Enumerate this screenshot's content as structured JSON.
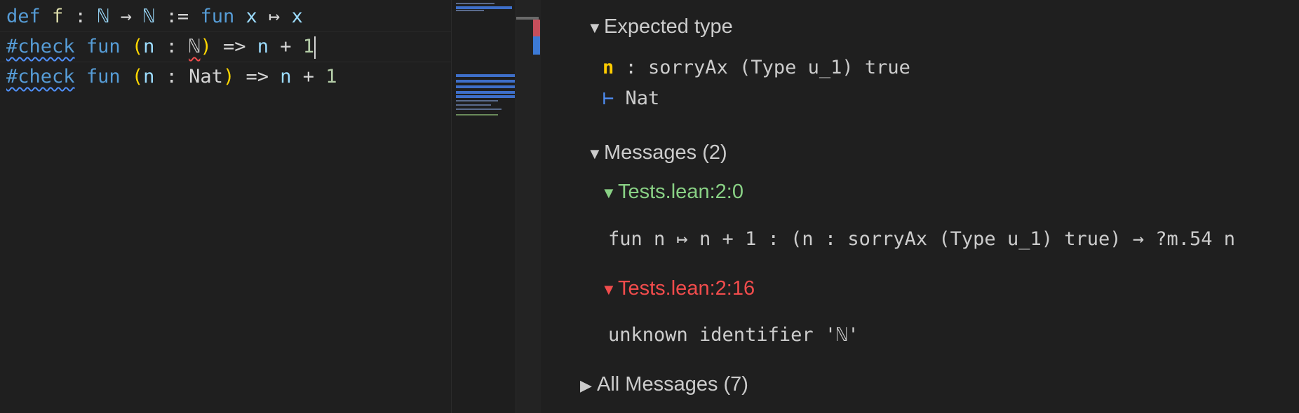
{
  "editor": {
    "lines": [
      {
        "tokens": [
          "def",
          " ",
          "f",
          " : ",
          "ℕ",
          " → ",
          "ℕ",
          " := ",
          "fun",
          " ",
          "x",
          " ↦ ",
          "x"
        ]
      },
      {
        "tokens": [
          "#check",
          " ",
          "fun",
          " ",
          "(",
          "n",
          " : ",
          "ℕ",
          ")",
          " => ",
          "n",
          " + ",
          "1"
        ]
      },
      {
        "tokens": [
          "#check",
          " ",
          "fun",
          " ",
          "(",
          "n",
          " : ",
          "Nat",
          ")",
          " => ",
          "n",
          " + ",
          "1"
        ]
      }
    ]
  },
  "infoview": {
    "expected_type": {
      "header": "Expected type",
      "hyp_name": "n",
      "hyp_type": " : sorryAx (Type u_1) true",
      "goal_symbol": "⊢",
      "goal": " Nat"
    },
    "messages": {
      "header": "Messages (2)",
      "items": [
        {
          "location": "Tests.lean:2:0",
          "text": "fun n ↦ n + 1 : (n : sorryAx (Type u_1) true) → ?m.54 n",
          "severity": "info"
        },
        {
          "location": "Tests.lean:2:16",
          "text": "unknown identifier 'ℕ'",
          "severity": "error"
        }
      ]
    },
    "all_messages": {
      "header": "All Messages (7)"
    }
  },
  "icons": {
    "expanded": "triangle-down",
    "collapsed": "triangle-right"
  },
  "colors": {
    "info": "#89d185",
    "error": "#f14c4c",
    "hyp": "#ffcc00"
  }
}
